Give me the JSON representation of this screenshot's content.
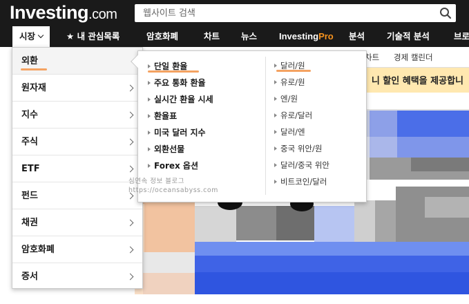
{
  "header": {
    "logo_main": "Investing",
    "logo_suffix": ".com",
    "search_placeholder": "웹사이트 검색"
  },
  "nav": {
    "items": [
      "시장",
      "내 관심목록",
      "암호화폐",
      "차트",
      "뉴스",
      "Investing",
      "Pro",
      "분석",
      "기술적 분석",
      "브로"
    ],
    "active_index": 0
  },
  "subnav": {
    "items": [
      "차트",
      "경제 캘린더"
    ]
  },
  "promo": {
    "text": "니 할인 혜택을 제공합니"
  },
  "menu_left": {
    "items": [
      "외환",
      "원자재",
      "지수",
      "주식",
      "ETF",
      "펀드",
      "채권",
      "암호화폐",
      "증서"
    ],
    "active_index": 0
  },
  "submenu": {
    "left_items": [
      "단일 환율",
      "주요 통화 환율",
      "실시간 환율 시세",
      "환율표",
      "미국 달러 지수",
      "외환선물",
      "Forex 옵션"
    ],
    "right_items": [
      "달러/원",
      "유로/원",
      "엔/원",
      "유로/달러",
      "달러/엔",
      "중국 위안/원",
      "달러/중국 위안",
      "비트코인/달러"
    ]
  },
  "watermark": {
    "line1": "심연속 정보 블로그",
    "line2": "https://oceansabyss.com"
  },
  "colors": {
    "header_bg": "#1a1a1a",
    "accent_orange": "#f4a261",
    "pro_orange": "#f7931e",
    "promo_bg": "#ffe8b0"
  }
}
